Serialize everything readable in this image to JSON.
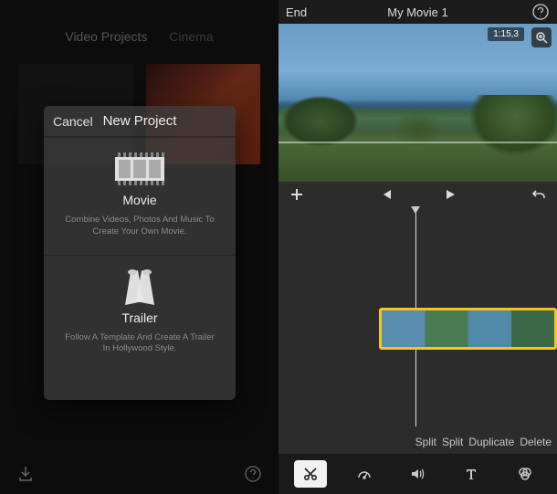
{
  "left": {
    "tabs": {
      "projects": "Video Projects",
      "cinema": "Cinema"
    },
    "modal": {
      "cancel": "Cancel",
      "title": "New Project",
      "movie": {
        "label": "Movie",
        "desc": "Combine Videos, Photos And Music To Create Your Own Movie."
      },
      "trailer": {
        "label": "Trailer",
        "desc": "Follow A Template And Create A Trailer In Hollywood Style."
      }
    }
  },
  "right": {
    "end_label": "End",
    "title": "My Movie 1",
    "preview_time": "1:15,3",
    "actions": {
      "split1": "Split",
      "split2": "Split",
      "duplicate": "Duplicate",
      "delete": "Delete"
    }
  }
}
